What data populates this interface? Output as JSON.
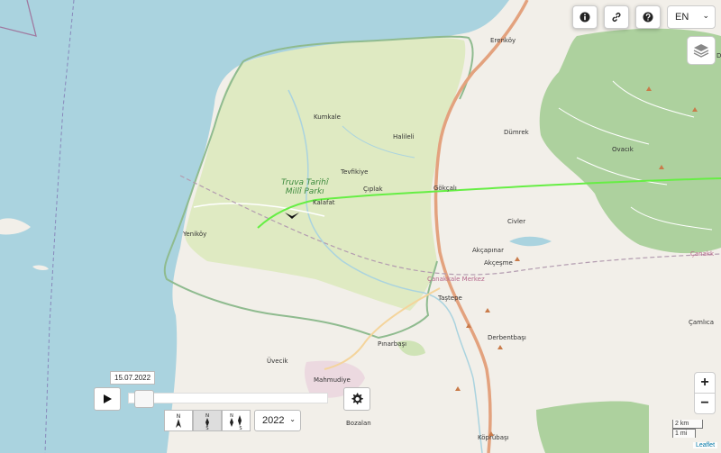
{
  "map": {
    "places": [
      {
        "id": "erenkoy",
        "label": "Erenköy"
      },
      {
        "id": "kumkale",
        "label": "Kumkale"
      },
      {
        "id": "halileli",
        "label": "Halileli"
      },
      {
        "id": "dumrek",
        "label": "Dümrek"
      },
      {
        "id": "ovacik",
        "label": "Ovacık"
      },
      {
        "id": "tevfikiye",
        "label": "Tevfikiye"
      },
      {
        "id": "ciplak",
        "label": "Çıplak"
      },
      {
        "id": "gokcali",
        "label": "Gökçalı"
      },
      {
        "id": "kalafat",
        "label": "Kalafat"
      },
      {
        "id": "civler",
        "label": "Civler"
      },
      {
        "id": "yenikoy",
        "label": "Yeniköy"
      },
      {
        "id": "akcapinar",
        "label": "Akçapınar"
      },
      {
        "id": "akcesme",
        "label": "Akçeşme"
      },
      {
        "id": "canakkale_merkez",
        "label": "Çanakkale Merkez"
      },
      {
        "id": "canakk",
        "label": "Çanakk"
      },
      {
        "id": "tastepe",
        "label": "Taştepe"
      },
      {
        "id": "derbentbasi",
        "label": "Derbentbaşı"
      },
      {
        "id": "camlica",
        "label": "Çamlıca"
      },
      {
        "id": "pinarbasi",
        "label": "Pınarbaşı"
      },
      {
        "id": "uvecik",
        "label": "Üvecik"
      },
      {
        "id": "mahmudiye",
        "label": "Mahmudiye"
      },
      {
        "id": "bozalan",
        "label": "Bozalan"
      },
      {
        "id": "koprubasi",
        "label": "Köprübaşı"
      },
      {
        "id": "d",
        "label": "D"
      }
    ],
    "park_label_line1": "Truva Tarihî",
    "park_label_line2": "Millî Parkı",
    "colors": {
      "sea": "#aad3df",
      "land": "#f2efe9",
      "park": "#dfeac2",
      "forest": "#add19e",
      "track": "#66ee44",
      "road": "#e3a27e"
    }
  },
  "controls": {
    "info_icon": "info-icon",
    "link_icon": "link-icon",
    "help_icon": "help-icon",
    "language": "EN",
    "layers_icon": "layers-icon",
    "zoom_in": "+",
    "zoom_out": "−",
    "scale_km": "2 km",
    "scale_mi": "1 mi",
    "attribution": "Leaflet"
  },
  "timeline": {
    "date": "15.07.2022",
    "progress": 0.03,
    "year": "2022",
    "orientation_buttons": [
      {
        "top": "N",
        "bottom": ""
      },
      {
        "top": "N",
        "bottom": "S"
      },
      {
        "top": "N",
        "bottom": "S"
      }
    ]
  }
}
